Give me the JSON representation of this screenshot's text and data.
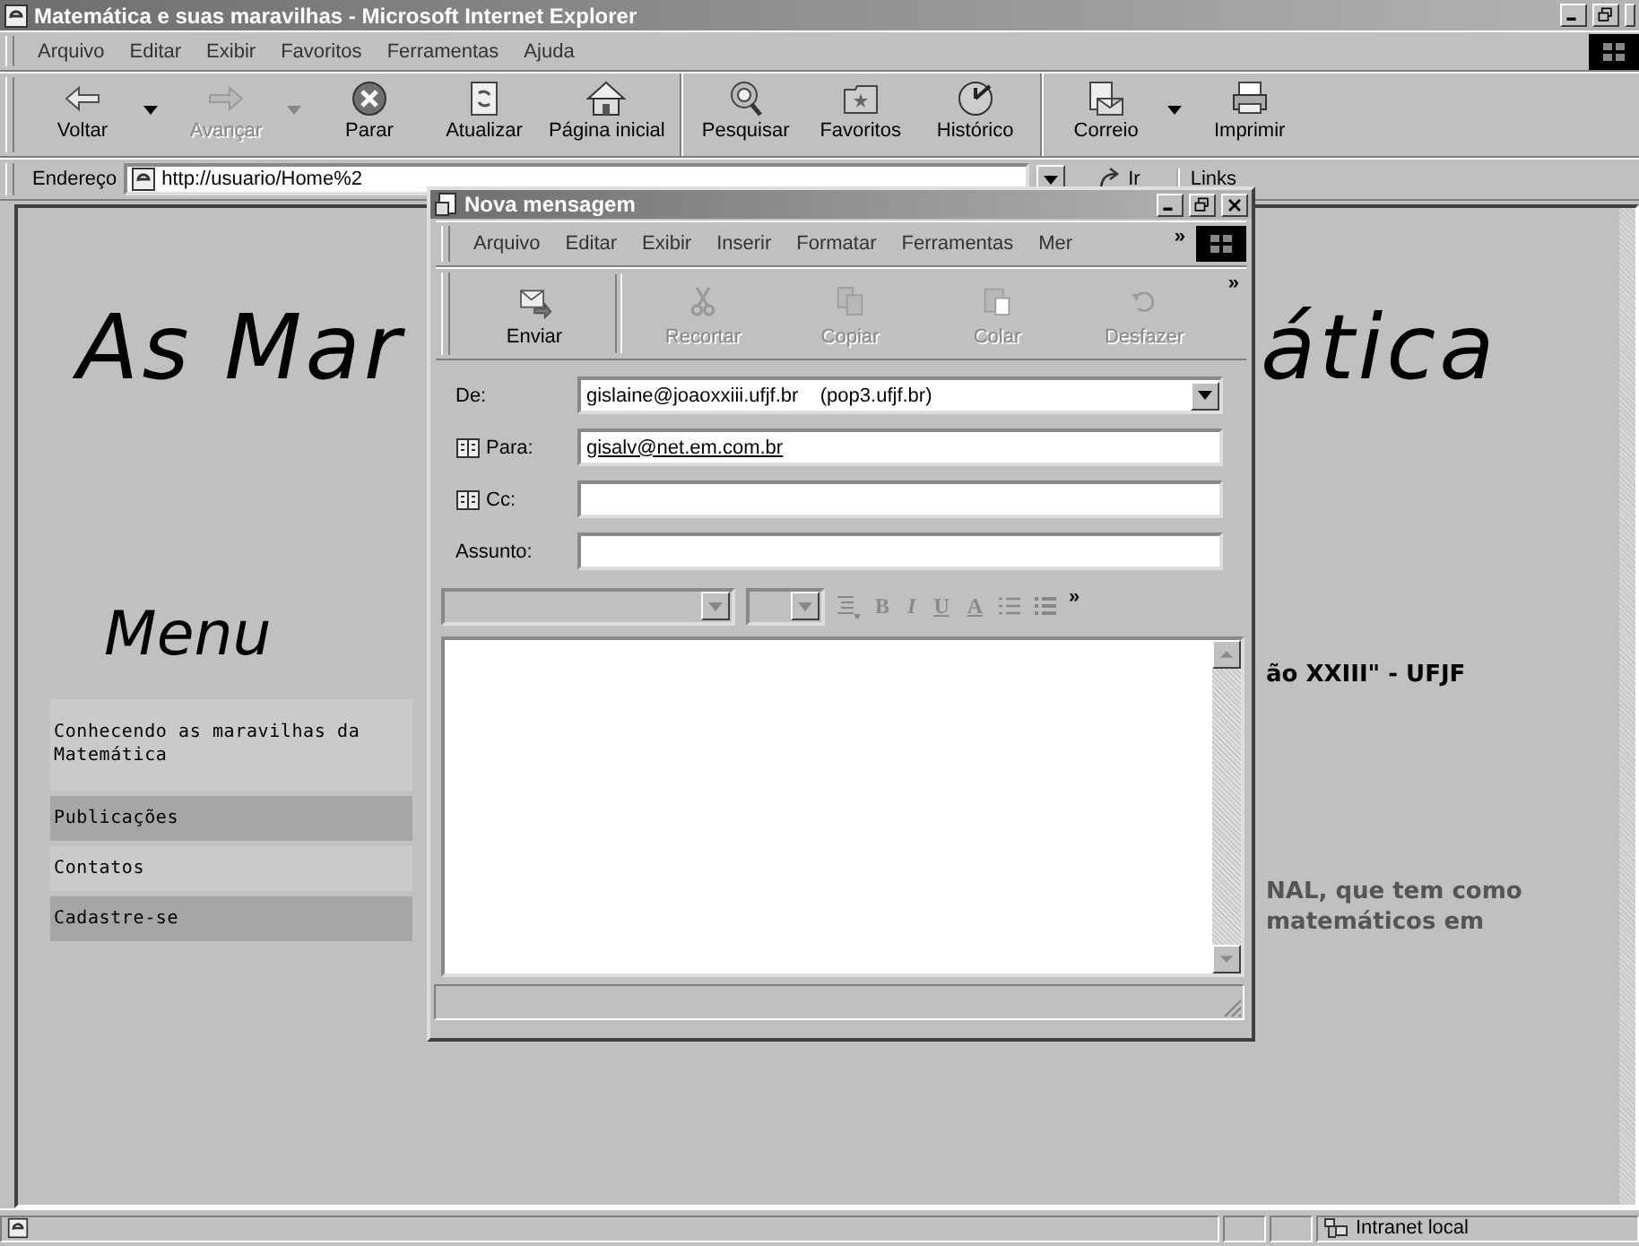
{
  "browser": {
    "title": "Matemática e suas maravilhas - Microsoft Internet Explorer",
    "menu": [
      "Arquivo",
      "Editar",
      "Exibir",
      "Favoritos",
      "Ferramentas",
      "Ajuda"
    ],
    "toolbar": [
      {
        "kind": "back",
        "label": "Voltar",
        "disabled": false,
        "dropdown": true,
        "separator_before": false
      },
      {
        "kind": "forward",
        "label": "Avançar",
        "disabled": true,
        "dropdown": true,
        "separator_before": false
      },
      {
        "kind": "stop",
        "label": "Parar",
        "disabled": false,
        "dropdown": false,
        "separator_before": false
      },
      {
        "kind": "refresh",
        "label": "Atualizar",
        "disabled": false,
        "dropdown": false,
        "separator_before": false
      },
      {
        "kind": "home",
        "label": "Página inicial",
        "disabled": false,
        "dropdown": false,
        "separator_before": false
      },
      {
        "kind": "search",
        "label": "Pesquisar",
        "disabled": false,
        "dropdown": false,
        "separator_before": true
      },
      {
        "kind": "favorites",
        "label": "Favoritos",
        "disabled": false,
        "dropdown": false,
        "separator_before": false
      },
      {
        "kind": "history",
        "label": "Histórico",
        "disabled": false,
        "dropdown": false,
        "separator_before": false
      },
      {
        "kind": "mail",
        "label": "Correio",
        "disabled": false,
        "dropdown": true,
        "separator_before": true
      },
      {
        "kind": "print",
        "label": "Imprimir",
        "disabled": false,
        "dropdown": false,
        "separator_before": false
      }
    ],
    "address": {
      "label": "Endereço",
      "value": "http://usuario/Home%2",
      "go": "Ir",
      "links": "Links"
    },
    "page": {
      "heading_left": "As Mar",
      "heading_right": "ática",
      "menu_title": "Menu",
      "menu_items": [
        "Conhecendo as maravilhas da Matemática",
        "Publicações",
        "Contatos",
        "Cadastre-se"
      ],
      "text_bold": "ão XXIII\" - UFJF",
      "text_lines": [
        "NAL, que tem como",
        "matemáticos em"
      ]
    },
    "status": {
      "zone": "Intranet local"
    }
  },
  "compose": {
    "title": "Nova mensagem",
    "menu": [
      "Arquivo",
      "Editar",
      "Exibir",
      "Inserir",
      "Formatar",
      "Ferramentas",
      "Mer"
    ],
    "menu_more": "»",
    "toolbar": [
      {
        "kind": "send",
        "label": "Enviar",
        "disabled": false
      },
      {
        "kind": "cut",
        "label": "Recortar",
        "disabled": true
      },
      {
        "kind": "copy",
        "label": "Copiar",
        "disabled": true
      },
      {
        "kind": "paste",
        "label": "Colar",
        "disabled": true
      },
      {
        "kind": "undo",
        "label": "Desfazer",
        "disabled": true
      }
    ],
    "toolbar_more": "»",
    "fields": [
      {
        "kind": "select",
        "label": "De:",
        "value": "gislaine@joaoxxiii.ufjf.br    (pop3.ufjf.br)",
        "address_book": false
      },
      {
        "kind": "recipients",
        "label": "Para:",
        "value": "gisalv@net.em.com.br",
        "address_book": true
      },
      {
        "kind": "recipients",
        "label": "Cc:",
        "address_book": true
      },
      {
        "kind": "text",
        "label": "Assunto:",
        "address_book": false
      }
    ],
    "format_buttons": [
      "B",
      "I",
      "U",
      "A"
    ],
    "format_more": "»"
  }
}
